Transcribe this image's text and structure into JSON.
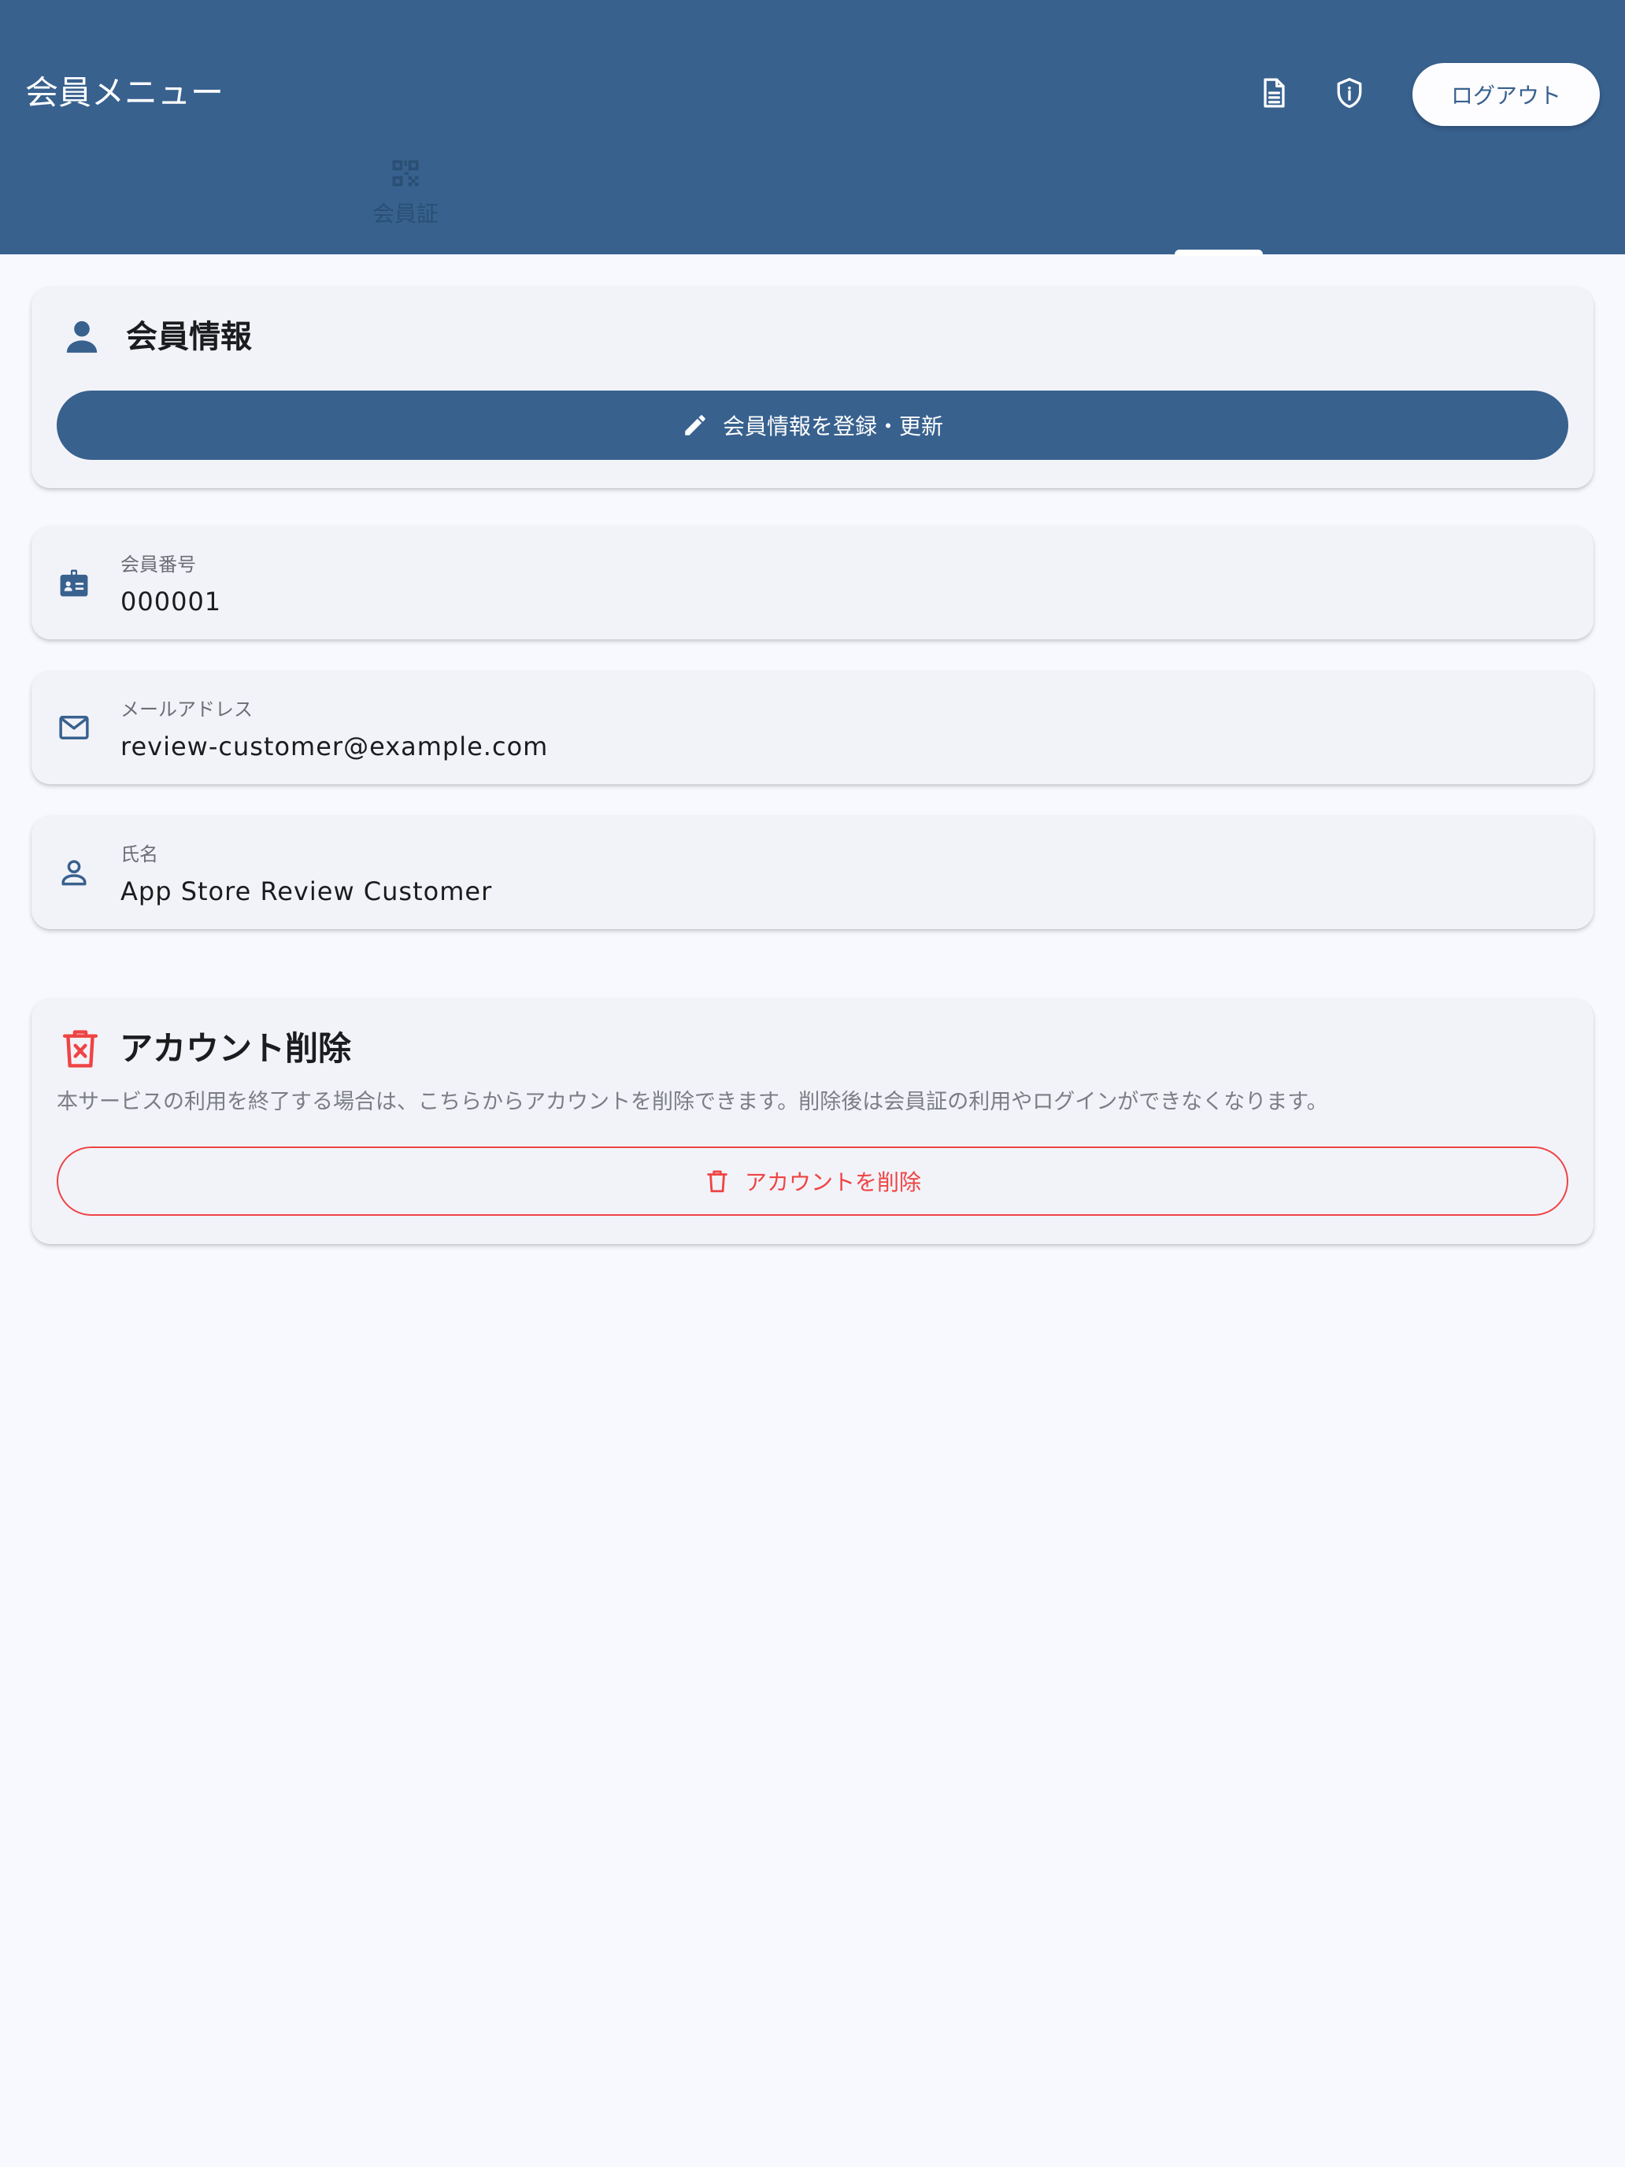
{
  "colors": {
    "primary": "#38618e",
    "background": "#f8f9fe",
    "card": "#f2f3f9",
    "danger": "#ef4444",
    "on_primary": "#ffffff",
    "text": "#1a1c1e",
    "muted": "#6b6e74"
  },
  "appbar": {
    "title": "会員メニュー",
    "icons": [
      "description-icon",
      "privacy-shield-icon"
    ],
    "logout_label": "ログアウト",
    "tabs": [
      {
        "label": "会員証",
        "icon": "qr-code-icon",
        "selected": false
      },
      {
        "label": "",
        "icon": "",
        "selected": true
      }
    ]
  },
  "member_info": {
    "title": "会員情報",
    "title_icon": "person-icon",
    "update_button": "会員情報を登録・更新",
    "update_icon": "edit-pencil-icon"
  },
  "fields": [
    {
      "label": "会員番号",
      "value": "000001",
      "icon": "badge-icon"
    },
    {
      "label": "メールアドレス",
      "value": "review-customer@example.com",
      "icon": "mail-icon"
    },
    {
      "label": "氏名",
      "value": "App Store Review Customer",
      "icon": "person-outline-icon"
    }
  ],
  "account_delete": {
    "title": "アカウント削除",
    "title_icon": "delete-forever-icon",
    "description": "本サービスの利用を終了する場合は、こちらからアカウントを削除できます。削除後は会員証の利用やログインができなくなります。",
    "button": "アカウントを削除",
    "button_icon": "trash-icon"
  }
}
